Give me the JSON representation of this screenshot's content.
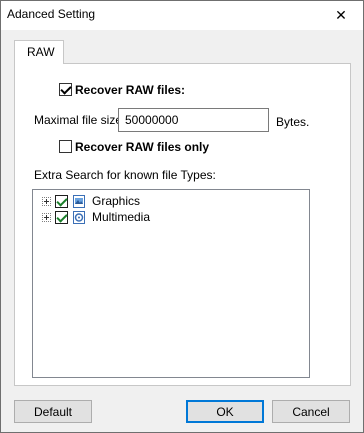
{
  "window": {
    "title": "Adanced Setting",
    "close_glyph": "✕"
  },
  "tabs": [
    {
      "label": "RAW"
    }
  ],
  "raw": {
    "recover_raw_label": "Recover RAW files:",
    "recover_raw_checked": true,
    "max_size_label": "Maximal file size:",
    "max_size_value": "50000000",
    "max_size_unit": "Bytes.",
    "recover_raw_only_label": "Recover RAW files only",
    "recover_raw_only_checked": false,
    "extra_search_label": "Extra Search for known file Types:",
    "file_types": [
      {
        "label": "Graphics",
        "checked": true,
        "icon": "graphics-icon"
      },
      {
        "label": "Multimedia",
        "checked": true,
        "icon": "multimedia-icon"
      }
    ]
  },
  "buttons": {
    "default_label": "Default",
    "ok_label": "OK",
    "cancel_label": "Cancel"
  },
  "colors": {
    "accent": "#0078d7",
    "check_green": "#1a7f2a"
  }
}
